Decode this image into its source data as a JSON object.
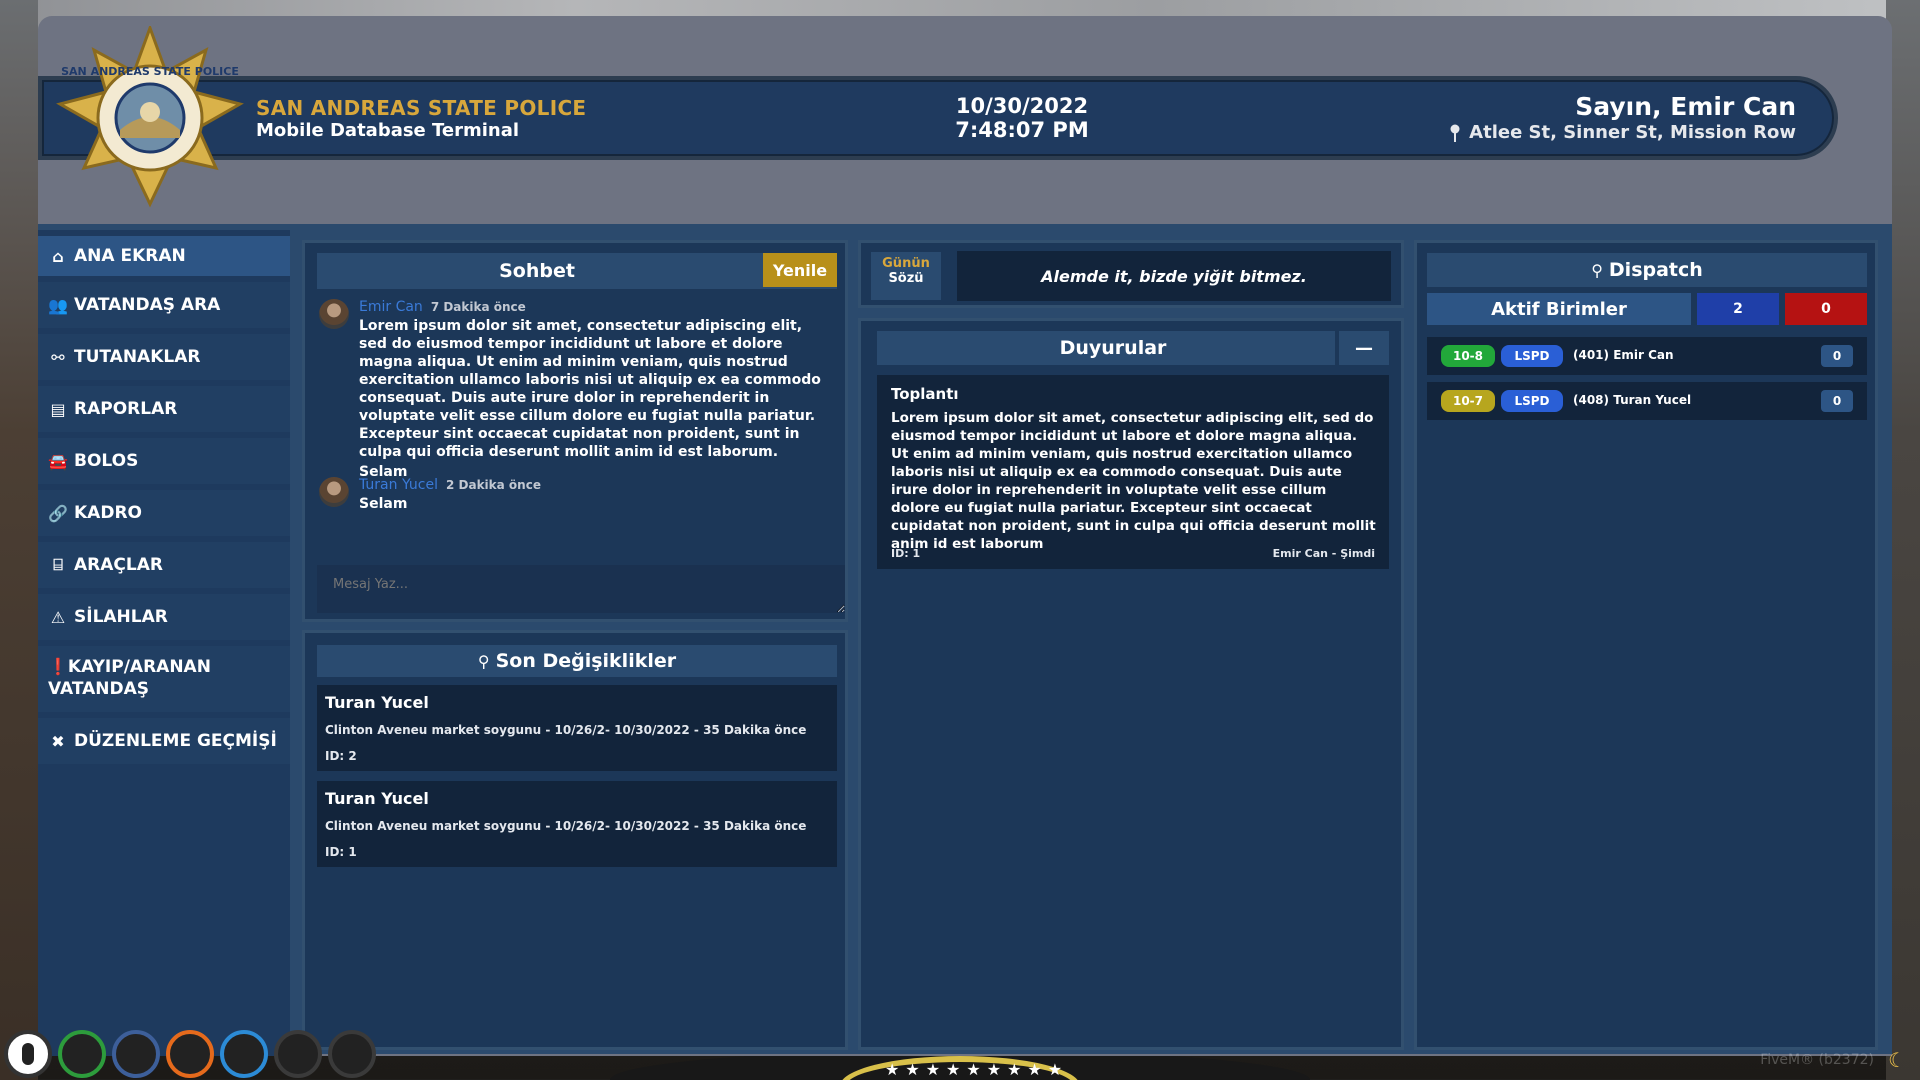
{
  "header": {
    "org_title": "SAN ANDREAS STATE POLICE",
    "subtitle": "Mobile Database Terminal",
    "date": "10/30/2022",
    "time": "7:48:07 PM",
    "user": "Sayın, Emir Can",
    "location": "Atlee St, Sinner St, Mission Row",
    "badge_text": "SAN ANDREAS STATE POLICE"
  },
  "sidebar": {
    "items": [
      {
        "label": "ANA EKRAN",
        "icon": "home-icon"
      },
      {
        "label": "VATANDAŞ ARA",
        "icon": "users-icon"
      },
      {
        "label": "TUTANAKLAR",
        "icon": "handcuffs-icon"
      },
      {
        "label": "RAPORLAR",
        "icon": "clipboard-icon"
      },
      {
        "label": "BOLOS",
        "icon": "car-icon"
      },
      {
        "label": "KADRO",
        "icon": "link-icon"
      },
      {
        "label": "ARAÇLAR",
        "icon": "garage-icon"
      },
      {
        "label": "SİLAHLAR",
        "icon": "warning-icon"
      },
      {
        "label": "KAYIP/ARANAN VATANDAŞ",
        "icon": "alert-circle-icon"
      },
      {
        "label": "DÜZENLEME GEÇMİŞİ",
        "icon": "tools-icon"
      }
    ]
  },
  "chat": {
    "title": "Sohbet",
    "refresh_label": "Yenile",
    "messages": [
      {
        "name": "Emir Can",
        "time": "7 Dakika önce",
        "text": "Lorem ipsum dolor sit amet, consectetur adipiscing elit, sed do eiusmod tempor incididunt ut labore et dolore magna aliqua. Ut enim ad minim veniam, quis nostrud exercitation ullamco laboris nisi ut aliquip ex ea commodo consequat. Duis aute irure dolor in reprehenderit in voluptate velit esse cillum dolore eu fugiat nulla pariatur. Excepteur sint occaecat cupidatat non proident, sunt in culpa qui officia deserunt mollit anim id est laborum.",
        "extra": "Selam"
      },
      {
        "name": "Turan Yucel",
        "time": "2 Dakika önce",
        "text": "Selam"
      }
    ],
    "input_placeholder": "Mesaj Yaz..."
  },
  "changes": {
    "title": "Son Değişiklikler",
    "items": [
      {
        "name": "Turan Yucel",
        "desc": "Clinton Aveneu market soygunu - 10/26/2- 10/30/2022 - 35 Dakika önce",
        "id": "ID: 2"
      },
      {
        "name": "Turan Yucel",
        "desc": "Clinton Aveneu market soygunu - 10/26/2- 10/30/2022 - 35 Dakika önce",
        "id": "ID: 1"
      }
    ]
  },
  "quote": {
    "label_line1": "Günün",
    "label_line2": "Sözü",
    "text": "Alemde it, bizde yiğit bitmez."
  },
  "announcements": {
    "title": "Duyurular",
    "collapse_label": "—",
    "items": [
      {
        "title": "Toplantı",
        "text": "Lorem ipsum dolor sit amet, consectetur adipiscing elit, sed do eiusmod tempor incididunt ut labore et dolore magna aliqua. Ut enim ad minim veniam, quis nostrud exercitation ullamco laboris nisi ut aliquip ex ea commodo consequat. Duis aute irure dolor in reprehenderit in voluptate velit esse cillum dolore eu fugiat nulla pariatur. Excepteur sint occaecat cupidatat non proident, sunt in culpa qui officia deserunt mollit anim id est laborum",
        "id": "ID: 1",
        "author": "Emir Can - Şimdi"
      }
    ]
  },
  "dispatch": {
    "title": "Dispatch",
    "active_units_label": "Aktif Birimler",
    "count_blue": "2",
    "count_red": "0",
    "units": [
      {
        "status": "10-8",
        "status_color": "#22a83a",
        "dept": "LSPD",
        "name": "(401) Emir Can",
        "count": "0"
      },
      {
        "status": "10-7",
        "status_color": "#b7a61e",
        "dept": "LSPD",
        "name": "(408) Turan Yucel",
        "count": "0"
      }
    ]
  },
  "footer": {
    "watermark": "FiveM® (b2372)"
  },
  "colors": {
    "accent_gold": "#d8a73c",
    "panel_dark": "#1c3758",
    "link_blue": "#3a7ad8",
    "count_blue": "#1f3fa8",
    "count_red": "#b51212"
  }
}
